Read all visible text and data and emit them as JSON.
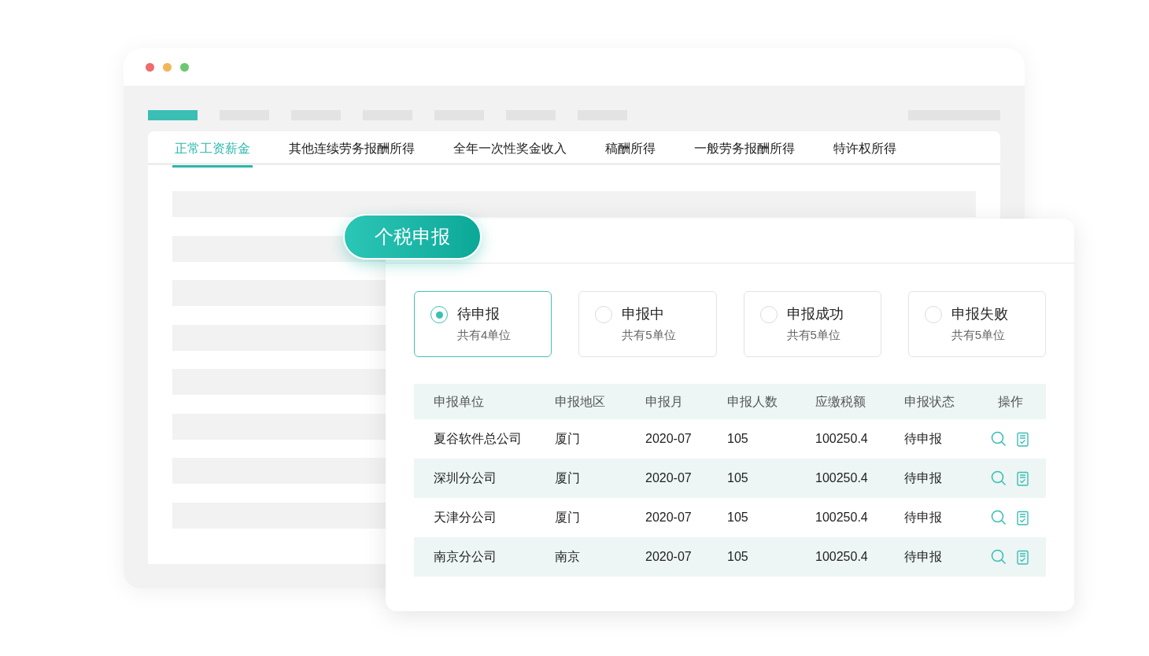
{
  "window": {
    "nav_items": [
      {
        "selected": true
      },
      {
        "selected": false
      },
      {
        "selected": false
      },
      {
        "selected": false
      },
      {
        "selected": false
      },
      {
        "selected": false
      },
      {
        "selected": false
      }
    ],
    "tabs": [
      {
        "label": "正常工资薪金",
        "selected": true
      },
      {
        "label": "其他连续劳务报酬所得",
        "selected": false
      },
      {
        "label": "全年一次性奖金收入",
        "selected": false
      },
      {
        "label": "稿酬所得",
        "selected": false
      },
      {
        "label": "一般劳务报酬所得",
        "selected": false
      },
      {
        "label": "特许权所得",
        "selected": false
      }
    ]
  },
  "panel": {
    "badge": "个税申报",
    "status_cards": [
      {
        "label": "待申报",
        "count": "共有4单位",
        "selected": true
      },
      {
        "label": "申报中",
        "count": "共有5单位",
        "selected": false
      },
      {
        "label": "申报成功",
        "count": "共有5单位",
        "selected": false
      },
      {
        "label": "申报失败",
        "count": "共有5单位",
        "selected": false
      }
    ],
    "table": {
      "columns": [
        "申报单位",
        "申报地区",
        "申报月",
        "申报人数",
        "应缴税额",
        "申报状态",
        "操作"
      ],
      "rows": [
        [
          "夏谷软件总公司",
          "厦门",
          "2020-07",
          "105",
          "100250.4",
          "待申报"
        ],
        [
          "深圳分公司",
          "厦门",
          "2020-07",
          "105",
          "100250.4",
          "待申报"
        ],
        [
          "天津分公司",
          "厦门",
          "2020-07",
          "105",
          "100250.4",
          "待申报"
        ],
        [
          "南京分公司",
          "南京",
          "2020-07",
          "105",
          "100250.4",
          "待申报"
        ]
      ]
    }
  }
}
